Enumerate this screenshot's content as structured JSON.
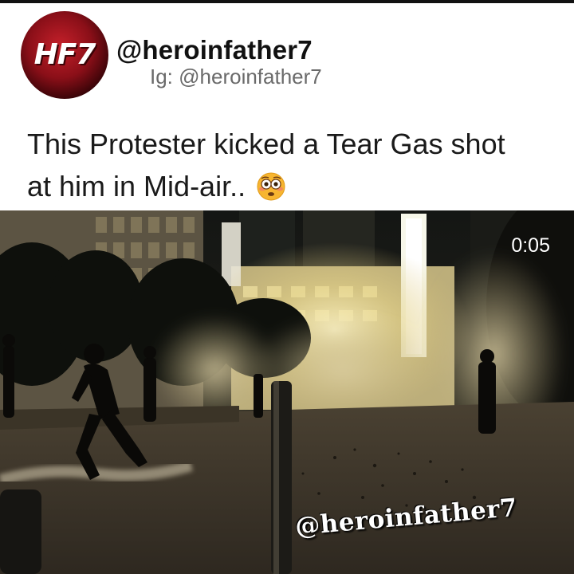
{
  "post": {
    "avatar_text": "HF7",
    "username": "@heroinfather7",
    "ig_handle": "Ig: @heroinfather7",
    "caption_line1": "This Protester kicked a Tear Gas shot",
    "caption_line2": "at him in Mid-air..",
    "caption_emoji": "flushed-face-emoji"
  },
  "video": {
    "timer": "0:05",
    "watermark": "@heroinfather7",
    "scene": "night-street-protest-tear-gas"
  },
  "colors": {
    "avatar_red": "#b5131d",
    "username_text": "#111111",
    "handle_text": "#6a6a6a",
    "caption_text": "#1a1a1a",
    "smoke": "#d8cba0"
  }
}
